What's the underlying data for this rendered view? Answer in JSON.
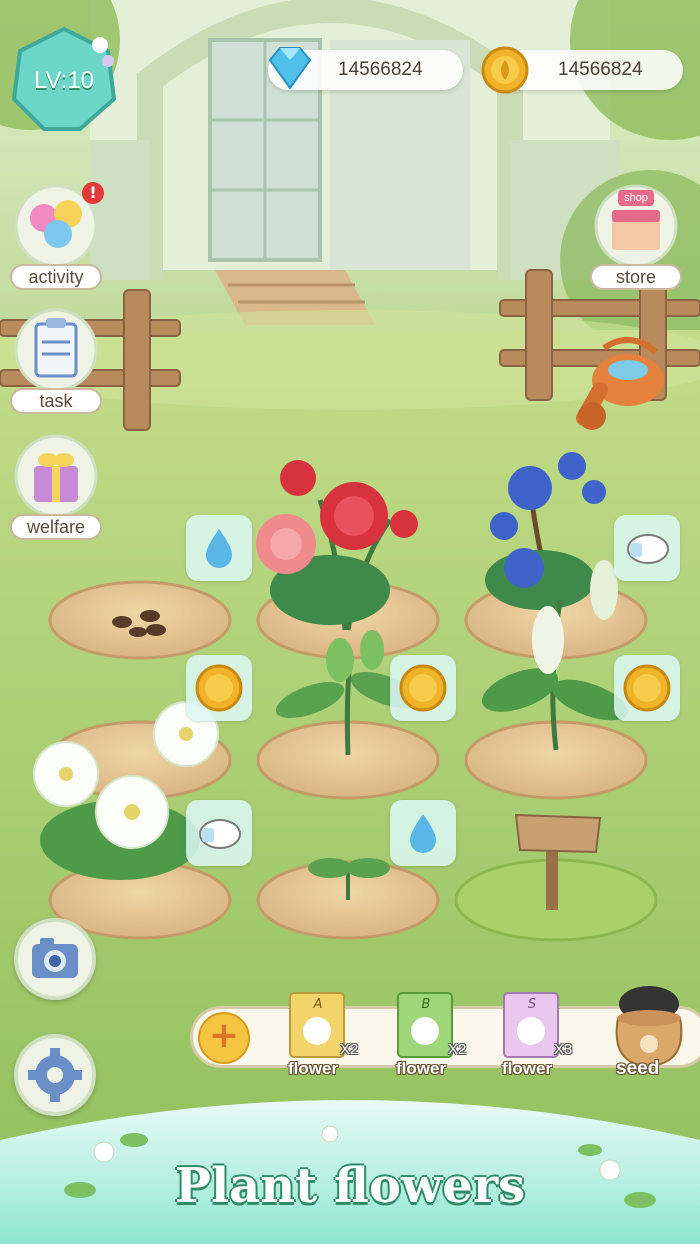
{
  "level": {
    "label": "LV:10"
  },
  "currencies": {
    "gems": {
      "value": "14566824",
      "icon": "diamond-icon"
    },
    "coins": {
      "value": "14566824",
      "icon": "coin-icon"
    }
  },
  "left_menu": [
    {
      "label": "activity",
      "icon": "balloons-icon",
      "has_alert": true,
      "alert": "!"
    },
    {
      "label": "task",
      "icon": "clipboard-icon"
    },
    {
      "label": "welfare",
      "icon": "gift-icon"
    }
  ],
  "right_menu": {
    "label": "store",
    "sign": "shop",
    "icon": "shop-icon"
  },
  "seed_tray": {
    "items": [
      {
        "letter": "A",
        "label": "flower",
        "count": "X2",
        "color": "#f2d46a"
      },
      {
        "letter": "B",
        "label": "flower",
        "count": "X2",
        "color": "#9fd67a"
      },
      {
        "letter": "S",
        "label": "flower",
        "count": "X3",
        "color": "#e9c7ee"
      }
    ],
    "seed_bag": {
      "label": "seed"
    }
  },
  "banner": {
    "title": "Plant flowers"
  },
  "colors": {
    "accent": "#2f8a68",
    "grass": "#9cc46a",
    "soil": "#e6c89a"
  }
}
